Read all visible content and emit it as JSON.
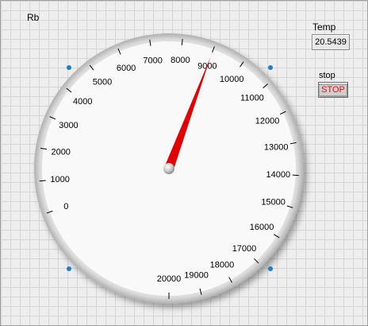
{
  "gauge": {
    "label": "Rb",
    "value": 9000,
    "min": 0,
    "max": 20000,
    "ticks": [
      "0",
      "1000",
      "2000",
      "3000",
      "4000",
      "5000",
      "6000",
      "7000",
      "8000",
      "9000",
      "10000",
      "11000",
      "12000",
      "13000",
      "14000",
      "15000",
      "16000",
      "17000",
      "18000",
      "19000",
      "20000"
    ]
  },
  "temp": {
    "label": "Temp",
    "value": "20.5439"
  },
  "stop": {
    "label": "stop",
    "button_label": "STOP"
  },
  "colors": {
    "needle": "#e00000",
    "stop_text": "#e01010",
    "selection_handle": "#1b7fd1"
  }
}
